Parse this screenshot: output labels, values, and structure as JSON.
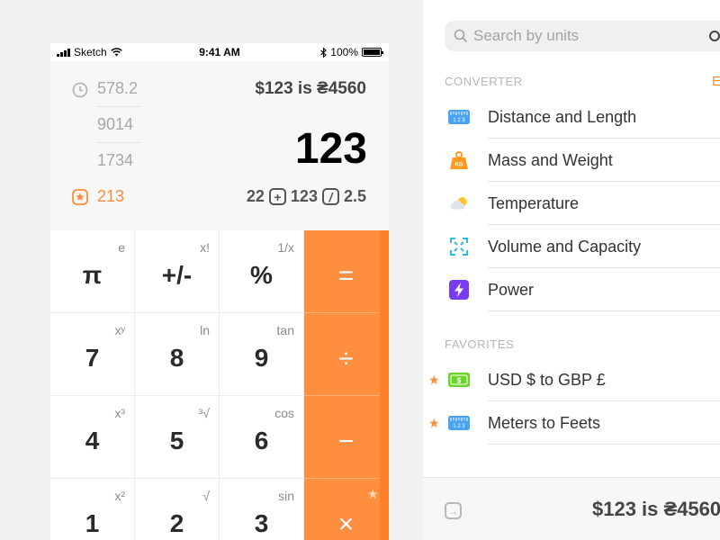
{
  "statusbar": {
    "carrier": "Sketch",
    "time": "9:41 AM",
    "battery": "100%"
  },
  "display": {
    "history": [
      "578.2",
      "9014",
      "1734"
    ],
    "favorite_value": "213",
    "conversion": "$123 is ₴4560",
    "current": "123",
    "memory": {
      "left": "22",
      "plus_icon": "+",
      "middle": "123",
      "div_icon": "/",
      "right": "2.5"
    }
  },
  "keypad": {
    "rows": [
      [
        {
          "main": "π",
          "sec": "e"
        },
        {
          "main": "+/-",
          "sec": "x!"
        },
        {
          "main": "%",
          "sec": "1/x"
        },
        {
          "main": "=",
          "sec": ""
        }
      ],
      [
        {
          "main": "7",
          "sec": "xʸ"
        },
        {
          "main": "8",
          "sec": "ln"
        },
        {
          "main": "9",
          "sec": "tan"
        },
        {
          "main": "÷",
          "sec": ""
        }
      ],
      [
        {
          "main": "4",
          "sec": "x³"
        },
        {
          "main": "5",
          "sec": "³√"
        },
        {
          "main": "6",
          "sec": "cos"
        },
        {
          "main": "−",
          "sec": ""
        }
      ],
      [
        {
          "main": "1",
          "sec": "x²"
        },
        {
          "main": "2",
          "sec": "√"
        },
        {
          "main": "3",
          "sec": "sin"
        },
        {
          "main": "×",
          "sec": "★"
        }
      ]
    ]
  },
  "panel": {
    "search": {
      "placeholder": "Search by units"
    },
    "converter_title": "CONVERTER",
    "edit_label": "E",
    "converters": [
      {
        "label": "Distance and Length",
        "icon": "ruler-icon"
      },
      {
        "label": "Mass and Weight",
        "icon": "weight-icon"
      },
      {
        "label": "Temperature",
        "icon": "weather-icon"
      },
      {
        "label": "Volume and Capacity",
        "icon": "volume-icon"
      },
      {
        "label": "Power",
        "icon": "bolt-icon"
      }
    ],
    "favorites_title": "FAVORITES",
    "favorites": [
      {
        "label": "USD $ to GBP £",
        "icon": "money-icon"
      },
      {
        "label": "Meters to Feets",
        "icon": "ruler-icon"
      }
    ],
    "footer_result": "$123 is ₴4560"
  },
  "colors": {
    "accent": "#ff8e3f",
    "ruler": "#4aa3f0",
    "weight": "#ff9a1f",
    "power": "#7a3cf0",
    "money": "#6bd42a"
  }
}
